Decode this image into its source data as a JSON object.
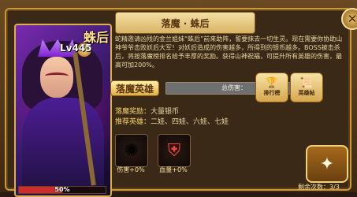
{
  "header": {
    "title": "落魔 · 蛛后"
  },
  "close": {
    "icon": "✕"
  },
  "boss": {
    "name": "蛛后",
    "level": "Lv445",
    "hp_text": "50%",
    "hp_percent": 50
  },
  "description": "蛇精邀请凶残的金兰姐妹“蛛后”前来助阵，誓要抹去一切生灵。现在需要你协助山神爷爷击败妖后大军！对妖后造成的伤害越多，所得到的银币越多。BOSS被击杀后，将按落魔榜排名给予丰厚的奖励。获得山神祝福，可提升所有英雄的伤害，最高可加200%。",
  "challenge": {
    "title": "落魔英雄",
    "damage_label": "总伤害："
  },
  "buttons": {
    "rank": "排行榜",
    "hero": "英雄帖"
  },
  "reward": {
    "label": "落魔奖励：",
    "value": "大量银币"
  },
  "recommend": {
    "label": "推荐英雄：",
    "value": "二娃、四娃、六娃、七娃"
  },
  "items": [
    {
      "label": "伤害+0%"
    },
    {
      "label": "血量+0%"
    }
  ],
  "remaining": {
    "label": "剩余次数：3/3"
  }
}
